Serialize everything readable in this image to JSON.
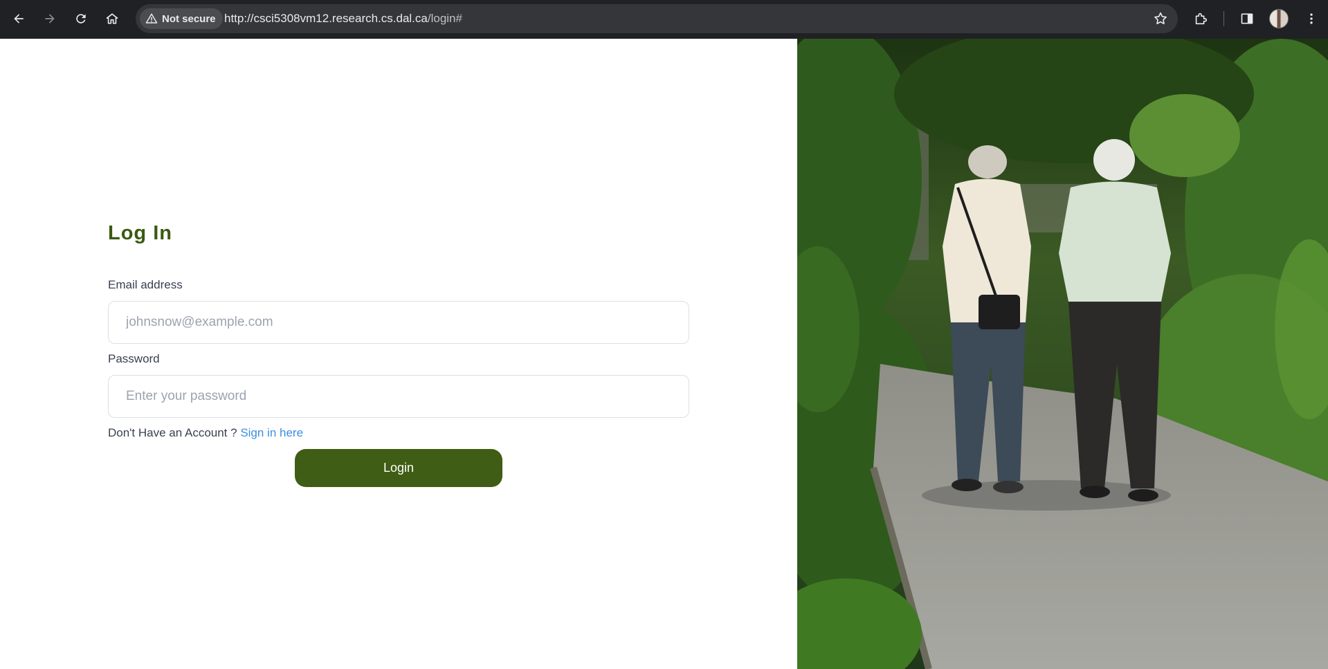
{
  "browser": {
    "security_label": "Not secure",
    "url_host": "http://csci5308vm12.research.cs.dal.ca",
    "url_path": "/login#"
  },
  "login": {
    "title": "Log In",
    "email_label": "Email address",
    "email_placeholder": "johnsnow@example.com",
    "password_label": "Password",
    "password_placeholder": "Enter your password",
    "no_account_text": "Don't Have an Account ? ",
    "signup_link": "Sign in here",
    "login_button": "Login"
  },
  "icons": [
    "back-icon",
    "forward-icon",
    "reload-icon",
    "home-icon",
    "warning-icon",
    "star-icon",
    "extensions-icon",
    "side-panel-icon",
    "profile-avatar",
    "menu-icon"
  ],
  "colors": {
    "brand_green": "#3f5d14",
    "title_green": "#3a5a12",
    "link_blue": "#3b8fe0",
    "chrome_bg": "#202124"
  }
}
